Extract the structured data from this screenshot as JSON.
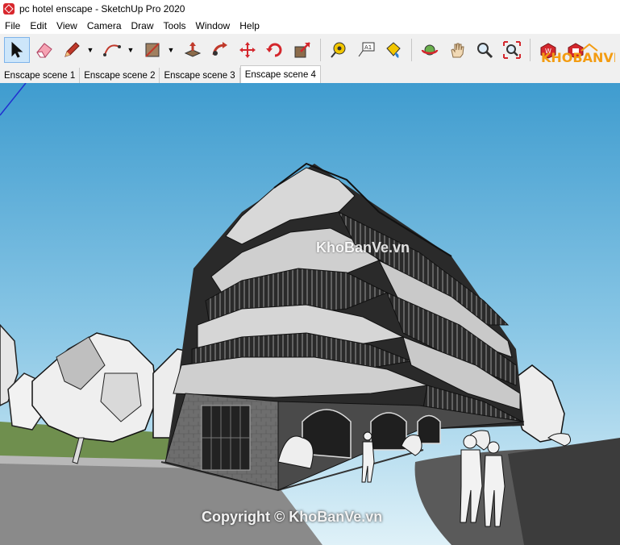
{
  "window": {
    "title": "pc hotel enscape - SketchUp Pro 2020"
  },
  "menu": [
    "File",
    "Edit",
    "View",
    "Camera",
    "Draw",
    "Tools",
    "Window",
    "Help"
  ],
  "toolbar": {
    "tools": [
      {
        "icon": "select-arrow-icon"
      },
      {
        "icon": "eraser-icon"
      },
      {
        "icon": "pencil-icon"
      },
      {
        "icon": "arc-icon"
      },
      {
        "icon": "rectangle-icon"
      },
      {
        "icon": "push-pull-icon"
      },
      {
        "icon": "follow-me-icon"
      },
      {
        "icon": "move-icon"
      },
      {
        "icon": "rotate-icon"
      },
      {
        "icon": "scale-icon"
      },
      {
        "icon": "tape-measure-icon"
      },
      {
        "icon": "text-icon"
      },
      {
        "icon": "paint-bucket-icon"
      },
      {
        "icon": "orbit-icon"
      },
      {
        "icon": "pan-icon"
      },
      {
        "icon": "zoom-icon"
      },
      {
        "icon": "zoom-extents-icon"
      },
      {
        "icon": "warehouse-icon"
      },
      {
        "icon": "extension-warehouse-icon"
      }
    ],
    "logo_text": "KHOBANVE"
  },
  "scene_tabs": [
    "Enscape scene 1",
    "Enscape scene 2",
    "Enscape scene 3",
    "Enscape scene 4"
  ],
  "active_tab": "Enscape scene 4",
  "viewport": {
    "watermark": "KhoBanVe.vn",
    "copyright": "Copyright © KhoBanVe.vn"
  },
  "colors": {
    "sky_top": "#4aa2d3",
    "sky_bottom": "#cbe8f4",
    "ground": "#8a8a8a",
    "grass": "#6f8f4e"
  }
}
